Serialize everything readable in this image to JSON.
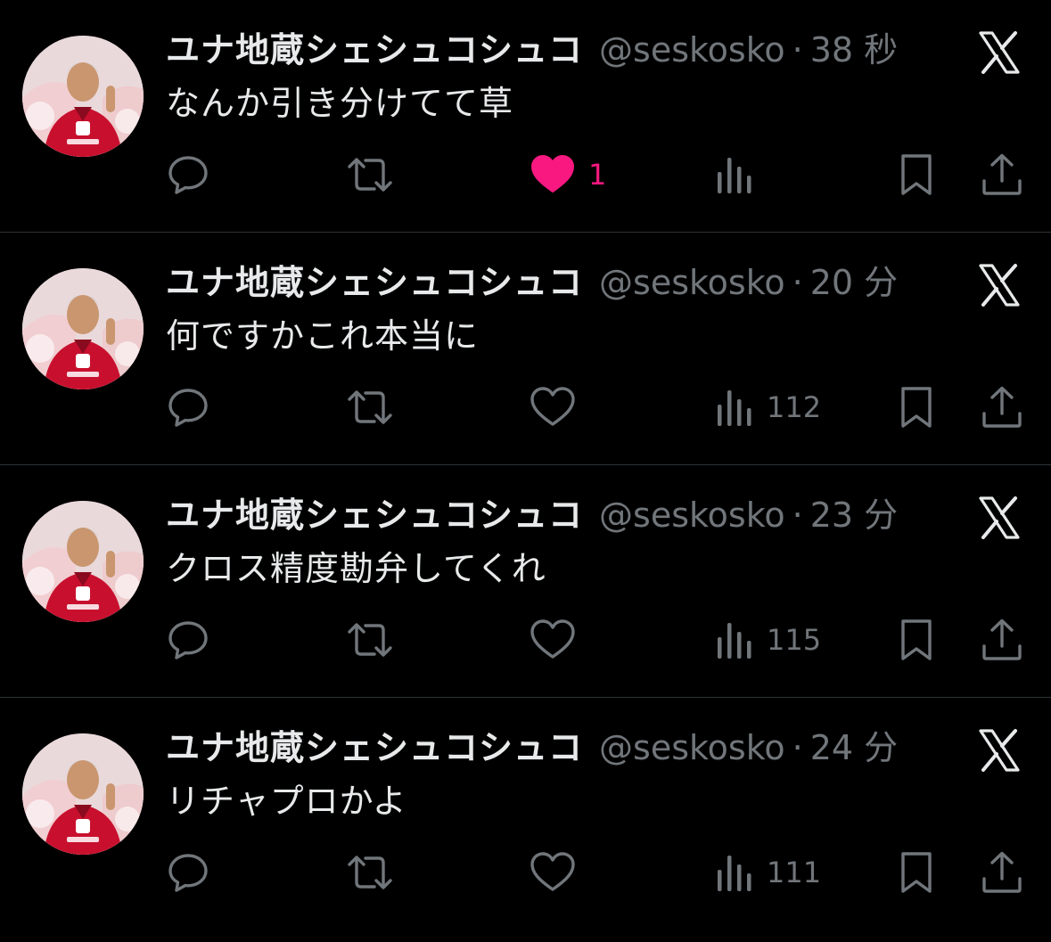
{
  "colors": {
    "background": "#000000",
    "text": "#e7e9ea",
    "muted": "#71767b",
    "like": "#f91880",
    "divider": "#2f3336"
  },
  "tweets": [
    {
      "display_name": "ユナ地蔵シェシュコシュコ",
      "handle": "@seskosko",
      "separator": "·",
      "time": "38 秒",
      "text": "なんか引き分けてて草",
      "liked": true,
      "like_count": "1",
      "view_count": "",
      "icons": [
        "reply-icon",
        "retweet-icon",
        "like-icon",
        "views-icon",
        "bookmark-icon",
        "share-icon",
        "x-logo-icon"
      ]
    },
    {
      "display_name": "ユナ地蔵シェシュコシュコ",
      "handle": "@seskosko",
      "separator": "·",
      "time": "20 分",
      "text": "何ですかこれ本当に",
      "liked": false,
      "like_count": "",
      "view_count": "112",
      "icons": [
        "reply-icon",
        "retweet-icon",
        "like-icon",
        "views-icon",
        "bookmark-icon",
        "share-icon",
        "x-logo-icon"
      ]
    },
    {
      "display_name": "ユナ地蔵シェシュコシュコ",
      "handle": "@seskosko",
      "separator": "·",
      "time": "23 分",
      "text": "クロス精度勘弁してくれ",
      "liked": false,
      "like_count": "",
      "view_count": "115",
      "icons": [
        "reply-icon",
        "retweet-icon",
        "like-icon",
        "views-icon",
        "bookmark-icon",
        "share-icon",
        "x-logo-icon"
      ]
    },
    {
      "display_name": "ユナ地蔵シェシュコシュコ",
      "handle": "@seskosko",
      "separator": "·",
      "time": "24 分",
      "text": "リチャプロかよ",
      "liked": false,
      "like_count": "",
      "view_count": "111",
      "icons": [
        "reply-icon",
        "retweet-icon",
        "like-icon",
        "views-icon",
        "bookmark-icon",
        "share-icon",
        "x-logo-icon"
      ]
    }
  ]
}
